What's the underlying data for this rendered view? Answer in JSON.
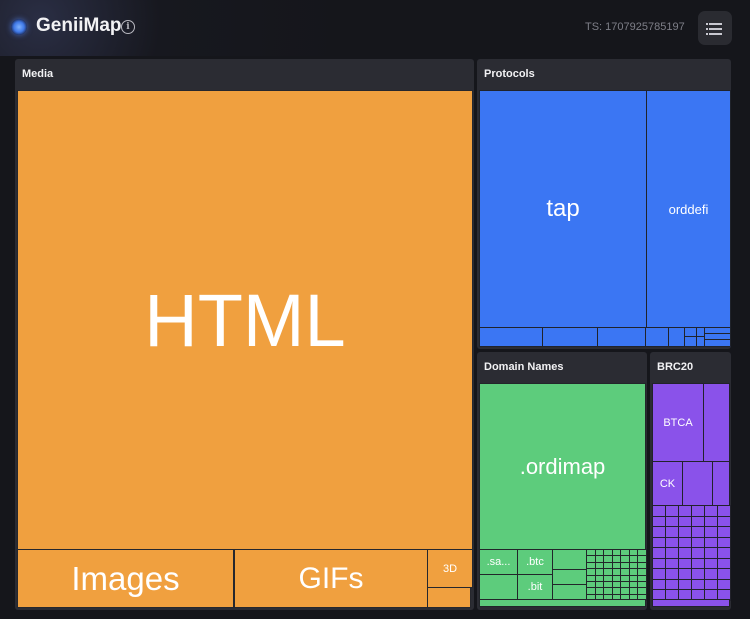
{
  "header": {
    "brand": "GeniiMap",
    "info_icon": "info-icon",
    "timestamp": "TS: 1707925785197",
    "menu_icon": "list-menu-icon"
  },
  "treemap": {
    "colors": {
      "media": "#f0a03f",
      "protocols": "#3b76f3",
      "domain_names": "#5dcc7c",
      "brc20": "#8a52ea",
      "background": "#15161b",
      "group_background": "#2b2c33"
    },
    "groups": {
      "media": {
        "title": "Media",
        "tiles": {
          "html": "HTML",
          "images": "Images",
          "gifs": "GIFs",
          "three_d": "3D"
        }
      },
      "protocols": {
        "title": "Protocols",
        "tiles": {
          "tap": "tap",
          "orddefi": "orddefi"
        }
      },
      "domain_names": {
        "title": "Domain Names",
        "tiles": {
          "ordimap": ".ordimap",
          "sats": ".sa...",
          "btc": ".btc",
          "bit": ".bit"
        }
      },
      "brc20": {
        "title": "BRC20",
        "tiles": {
          "btca": "BTCA",
          "ck": "CK"
        }
      }
    }
  }
}
